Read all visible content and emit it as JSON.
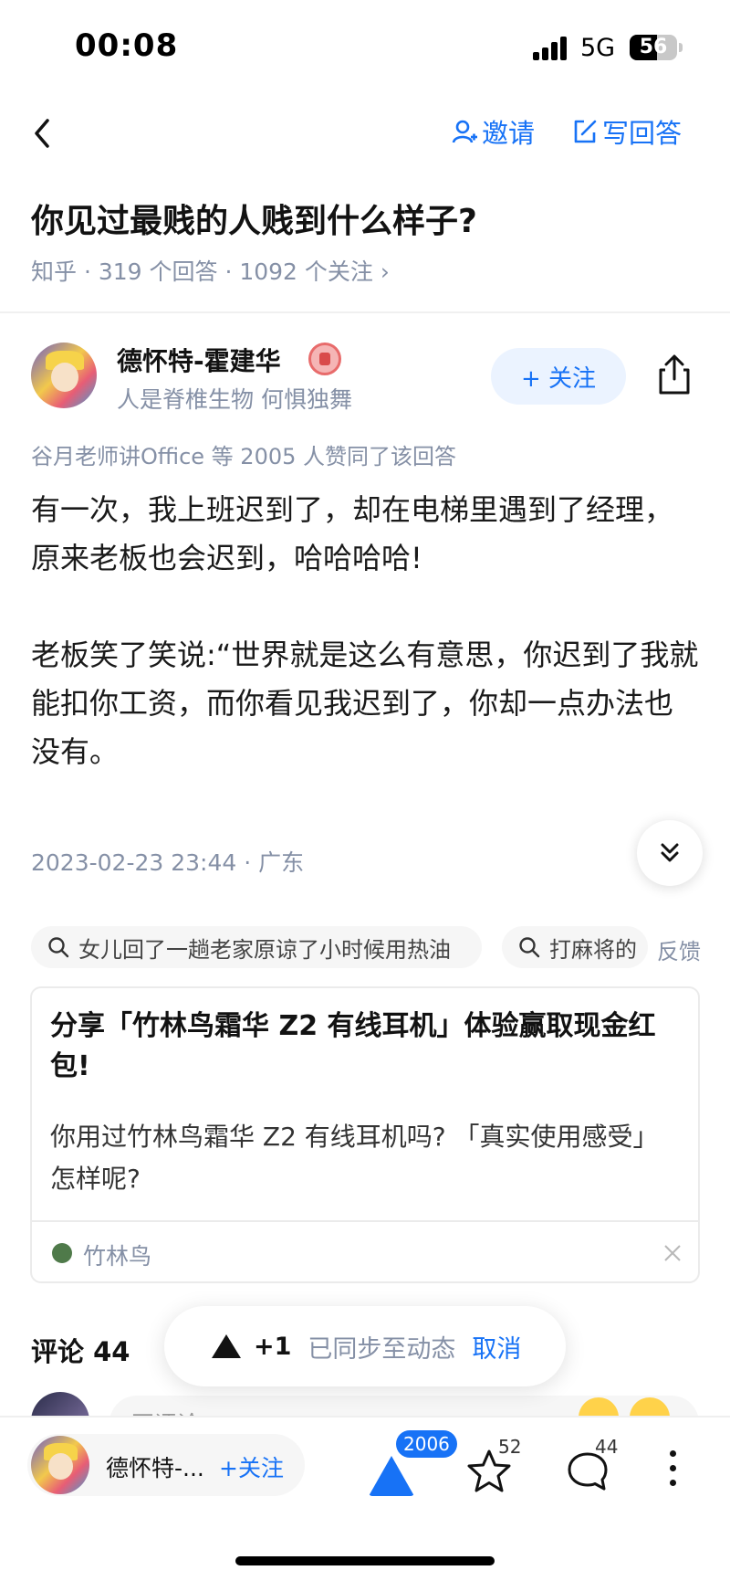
{
  "status_bar": {
    "time": "00:08",
    "network": "5G",
    "battery": "56"
  },
  "nav": {
    "invite_label": "邀请",
    "write_answer_label": "写回答"
  },
  "question": {
    "title": "你见过最贱的人贱到什么样子?",
    "meta": "知乎 · 319 个回答 · 1092 个关注 ›"
  },
  "author": {
    "name": "德怀特-霍建华",
    "bio": "人是脊椎生物 何惧独舞",
    "follow_label": "+ 关注"
  },
  "upvote_note": "谷月老师讲Office 等 2005 人赞同了该回答",
  "answer": {
    "paragraphs": [
      "有一次，我上班迟到了，却在电梯里遇到了经理，原来老板也会迟到，哈哈哈哈!",
      "老板笑了笑说:“世界就是这么有意思，你迟到了我就能扣你工资，而你看见我迟到了，你却一点办法也没有。"
    ],
    "time": "2023-02-23 23:44 · 广东"
  },
  "search_tags": [
    "女儿回了一趟老家原谅了小时候用热油",
    "打麻将的"
  ],
  "feedback_label": "反馈",
  "promo": {
    "title": "分享「竹林鸟霜华 Z2 有线耳机」体验赢取现金红包!",
    "desc": "你用过竹林鸟霜华 Z2 有线耳机吗? 「真实使用感受」怎样呢?",
    "brand": "竹林鸟"
  },
  "comments": {
    "title": "评论 44",
    "input_placeholder": "写评论..."
  },
  "toast": {
    "count": "+1",
    "message": "已同步至动态",
    "cancel": "取消"
  },
  "bottom_bar": {
    "author_name": "德怀特-...",
    "follow_label": "+关注",
    "vote_count": "2006",
    "favorite_count": "52",
    "comment_count": "44"
  },
  "colors": {
    "accent": "#1772f6",
    "meta_gray": "#8590a6"
  }
}
